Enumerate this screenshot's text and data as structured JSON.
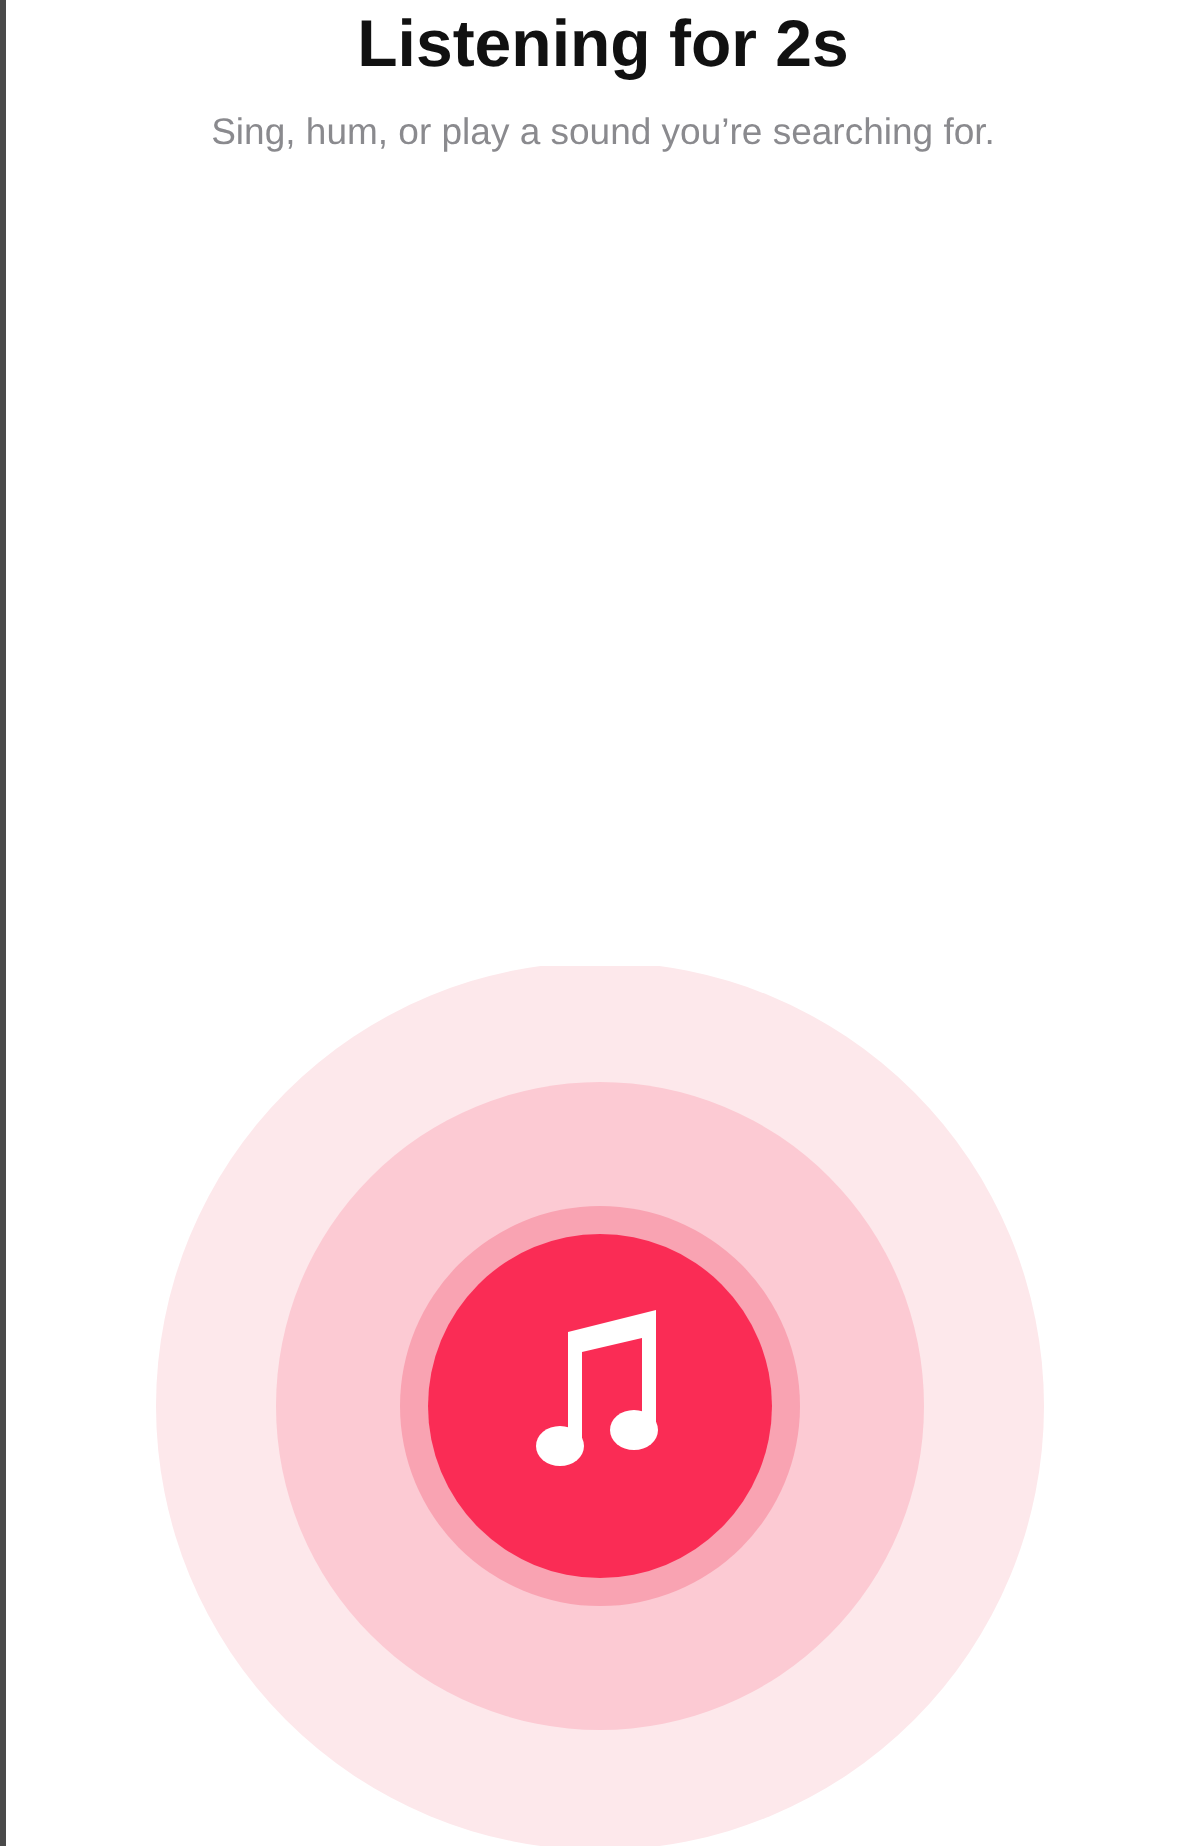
{
  "header": {
    "title": "Listening for 2s",
    "subtitle": "Sing, hum, or play a sound you’re searching for."
  }
}
